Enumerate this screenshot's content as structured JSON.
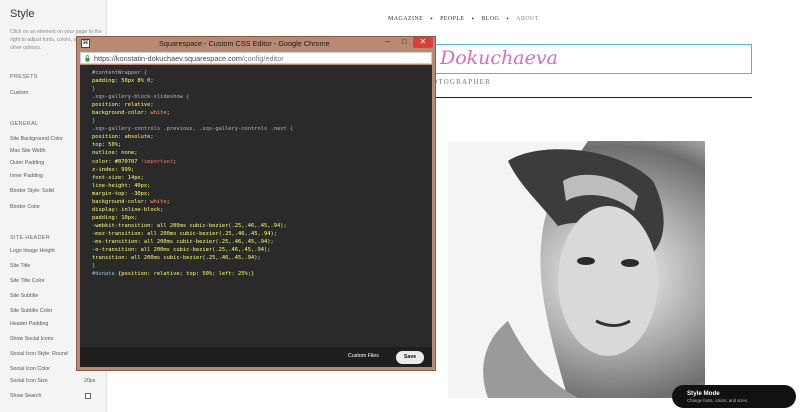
{
  "panel": {
    "title": "Style",
    "description": "Click on an element on your page to the right to adjust fonts, colors, sizes, and other options.",
    "sections": [
      {
        "heading": "PRESETS",
        "items": [
          "Custom"
        ]
      },
      {
        "heading": "GENERAL",
        "items": [
          "Site Background Color",
          "Max Site Width",
          "Outer Padding",
          "Inner Padding",
          "Border Style: Solid",
          "Border Color"
        ]
      },
      {
        "heading": "SITE HEADER",
        "items": [
          "Logo Image Height",
          "Site Title",
          "Site Title Color",
          "Site Subtitle",
          "Site Subtitle Color",
          "Header Padding",
          "Show Social Icons",
          "Social Icon Style: Round",
          "Social Icon Color",
          "Social Icon Size",
          "Show Search"
        ]
      }
    ],
    "social_icon_size_value": "20px"
  },
  "site": {
    "nav": [
      "MAGAZINE",
      "PEOPLE",
      "BLOG",
      "ABOUT"
    ],
    "title_visible": "Dokuchaeva",
    "subtitle_visible": "OTOGRAPHER"
  },
  "style_mode": {
    "title": "Style Mode",
    "subtitle": "Change fonts, colors, and sizes."
  },
  "popup": {
    "title": "Squarespace - Custom CSS Editor - Google Chrome",
    "url_host": "https://konstatin-dokuchaev.squarespace.com",
    "url_path": "/config/editor",
    "footer": {
      "custom_files": "Custom Files",
      "save": "Save"
    },
    "code": [
      [
        [
          "sel",
          "#contentWrapper {"
        ]
      ],
      [
        [
          "prop",
          "padding: 50px 8% 0;"
        ]
      ],
      [
        [
          "sel",
          "}"
        ]
      ],
      [
        [
          "sel",
          ".sqs-gallery-block-slideshow {"
        ]
      ],
      [
        [
          "prop",
          "position: relative;"
        ]
      ],
      [
        [
          "prop",
          "background-color: "
        ],
        [
          "kw",
          "white"
        ],
        [
          "prop",
          ";"
        ]
      ],
      [
        [
          "sel",
          "}"
        ]
      ],
      [
        [
          "sel",
          ".sqs-gallery-controls .previous, .sqs-gallery-controls .next {"
        ]
      ],
      [
        [
          "prop",
          "position: absolute;"
        ]
      ],
      [
        [
          "prop",
          "top: 50%;"
        ]
      ],
      [
        [
          "prop",
          "outline: none;"
        ]
      ],
      [
        [
          "prop",
          "color: #070707 "
        ],
        [
          "red",
          "!important"
        ],
        [
          "prop",
          ";"
        ]
      ],
      [
        [
          "prop",
          "z-index: 999;"
        ]
      ],
      [
        [
          "prop",
          "font-size: 14px;"
        ]
      ],
      [
        [
          "prop",
          "line-height: 40px;"
        ]
      ],
      [
        [
          "prop",
          "margin-top: -30px;"
        ]
      ],
      [
        [
          "prop",
          "background-color: "
        ],
        [
          "kw",
          "white"
        ],
        [
          "prop",
          ";"
        ]
      ],
      [
        [
          "prop",
          "display: inline-block;"
        ]
      ],
      [
        [
          "prop",
          "padding: 10px;"
        ]
      ],
      [
        [
          "prop",
          "-webkit-transition: all 200ms cubic-bezier(.25,.46,.45,.94);"
        ]
      ],
      [
        [
          "prop",
          "-moz-transition: all 200ms cubic-bezier(.25,.46,.45,.94);"
        ]
      ],
      [
        [
          "prop",
          "-ms-transition: all 200ms cubic-bezier(.25,.46,.45,.94);"
        ]
      ],
      [
        [
          "prop",
          "-o-transition: all 200ms cubic-bezier(.25,.46,.45,.94);"
        ]
      ],
      [
        [
          "prop",
          "transition: all 200ms cubic-bezier(.25,.46,.45,.94);"
        ]
      ],
      [
        [
          "sel",
          "}"
        ]
      ],
      [
        [
          "cmt",
          "#donate"
        ],
        [
          "prop",
          " {position: relative; top: 50%; left: 25%;}"
        ]
      ]
    ]
  }
}
